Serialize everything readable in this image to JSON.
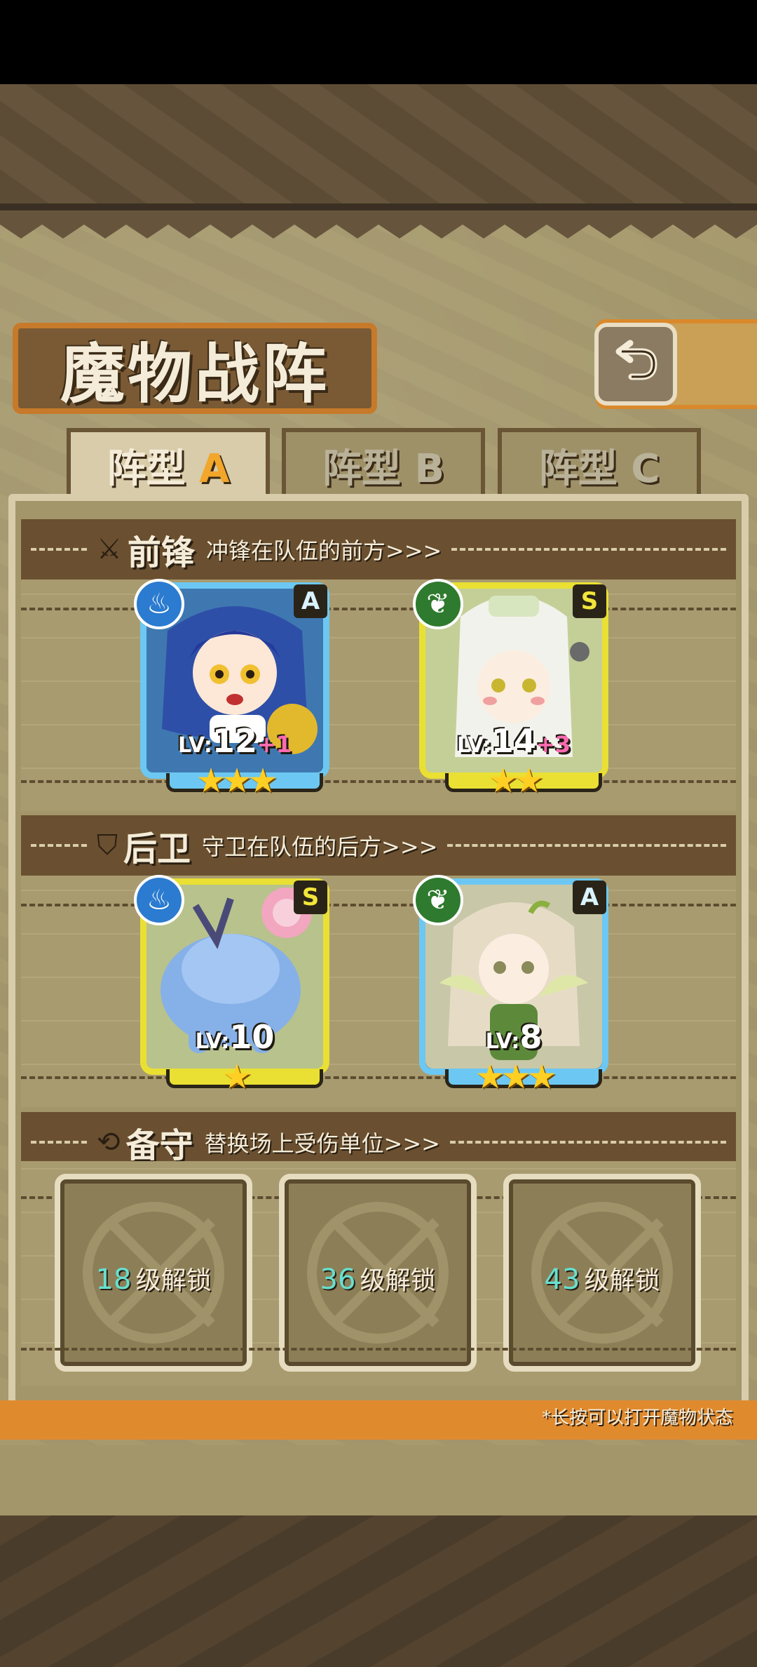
{
  "title": "魔物战阵",
  "tabs": [
    {
      "label_prefix": "阵型",
      "label_letter": "A",
      "active": true
    },
    {
      "label_prefix": "阵型",
      "label_letter": "B",
      "active": false
    },
    {
      "label_prefix": "阵型",
      "label_letter": "C",
      "active": false
    }
  ],
  "sections": {
    "vanguard": {
      "title": "前锋",
      "subtitle": "冲锋在队伍的前方>>>"
    },
    "rearguard": {
      "title": "后卫",
      "subtitle": "守卫在队伍的后方>>>"
    },
    "reserve": {
      "title": "备守",
      "subtitle": "替换场上受伤单位>>>"
    }
  },
  "units": [
    {
      "rank": "A",
      "element": "water",
      "level_prefix": "LV:",
      "level": "12",
      "bonus": "+1",
      "stars": "★★★",
      "star_count": 3
    },
    {
      "rank": "S",
      "element": "leaf",
      "level_prefix": "LV:",
      "level": "14",
      "bonus": "+3",
      "stars": "★★",
      "star_count": 2
    },
    {
      "rank": "S",
      "element": "water",
      "level_prefix": "LV:",
      "level": "10",
      "bonus": "",
      "stars": "★",
      "star_count": 1
    },
    {
      "rank": "A",
      "element": "leaf",
      "level_prefix": "LV:",
      "level": "8",
      "bonus": "",
      "stars": "★★★",
      "star_count": 3
    }
  ],
  "reserve_slots": [
    {
      "level": "18",
      "label": "级解锁"
    },
    {
      "level": "36",
      "label": "级解锁"
    },
    {
      "level": "43",
      "label": "级解锁"
    }
  ],
  "footnote": "*长按可以打开魔物状态",
  "icons": {
    "back": "back-arrow-icon",
    "vanguard": "sword-icon",
    "rearguard": "shield-icon",
    "reserve": "swap-icon",
    "water": "water-element-icon",
    "leaf": "leaf-element-icon"
  },
  "colors": {
    "accent": "#e08a2e",
    "rank_a_frame": "#6cc8f2",
    "rank_s_frame": "#e9e033",
    "lock_level": "#66e0d0"
  }
}
